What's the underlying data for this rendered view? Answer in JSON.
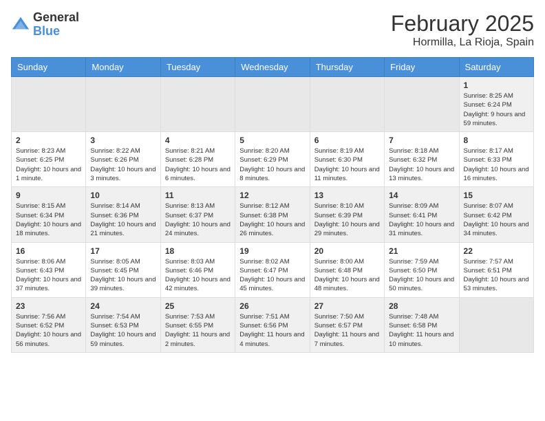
{
  "header": {
    "logo": {
      "general": "General",
      "blue": "Blue"
    },
    "title": "February 2025",
    "location": "Hormilla, La Rioja, Spain"
  },
  "calendar": {
    "days_of_week": [
      "Sunday",
      "Monday",
      "Tuesday",
      "Wednesday",
      "Thursday",
      "Friday",
      "Saturday"
    ],
    "weeks": [
      [
        {
          "day": "",
          "empty": true
        },
        {
          "day": "",
          "empty": true
        },
        {
          "day": "",
          "empty": true
        },
        {
          "day": "",
          "empty": true
        },
        {
          "day": "",
          "empty": true
        },
        {
          "day": "",
          "empty": true
        },
        {
          "day": "1",
          "sunrise": "Sunrise: 8:25 AM",
          "sunset": "Sunset: 6:24 PM",
          "daylight": "Daylight: 9 hours and 59 minutes."
        }
      ],
      [
        {
          "day": "2",
          "sunrise": "Sunrise: 8:23 AM",
          "sunset": "Sunset: 6:25 PM",
          "daylight": "Daylight: 10 hours and 1 minute."
        },
        {
          "day": "3",
          "sunrise": "Sunrise: 8:22 AM",
          "sunset": "Sunset: 6:26 PM",
          "daylight": "Daylight: 10 hours and 3 minutes."
        },
        {
          "day": "4",
          "sunrise": "Sunrise: 8:21 AM",
          "sunset": "Sunset: 6:28 PM",
          "daylight": "Daylight: 10 hours and 6 minutes."
        },
        {
          "day": "5",
          "sunrise": "Sunrise: 8:20 AM",
          "sunset": "Sunset: 6:29 PM",
          "daylight": "Daylight: 10 hours and 8 minutes."
        },
        {
          "day": "6",
          "sunrise": "Sunrise: 8:19 AM",
          "sunset": "Sunset: 6:30 PM",
          "daylight": "Daylight: 10 hours and 11 minutes."
        },
        {
          "day": "7",
          "sunrise": "Sunrise: 8:18 AM",
          "sunset": "Sunset: 6:32 PM",
          "daylight": "Daylight: 10 hours and 13 minutes."
        },
        {
          "day": "8",
          "sunrise": "Sunrise: 8:17 AM",
          "sunset": "Sunset: 6:33 PM",
          "daylight": "Daylight: 10 hours and 16 minutes."
        }
      ],
      [
        {
          "day": "9",
          "sunrise": "Sunrise: 8:15 AM",
          "sunset": "Sunset: 6:34 PM",
          "daylight": "Daylight: 10 hours and 18 minutes."
        },
        {
          "day": "10",
          "sunrise": "Sunrise: 8:14 AM",
          "sunset": "Sunset: 6:36 PM",
          "daylight": "Daylight: 10 hours and 21 minutes."
        },
        {
          "day": "11",
          "sunrise": "Sunrise: 8:13 AM",
          "sunset": "Sunset: 6:37 PM",
          "daylight": "Daylight: 10 hours and 24 minutes."
        },
        {
          "day": "12",
          "sunrise": "Sunrise: 8:12 AM",
          "sunset": "Sunset: 6:38 PM",
          "daylight": "Daylight: 10 hours and 26 minutes."
        },
        {
          "day": "13",
          "sunrise": "Sunrise: 8:10 AM",
          "sunset": "Sunset: 6:39 PM",
          "daylight": "Daylight: 10 hours and 29 minutes."
        },
        {
          "day": "14",
          "sunrise": "Sunrise: 8:09 AM",
          "sunset": "Sunset: 6:41 PM",
          "daylight": "Daylight: 10 hours and 31 minutes."
        },
        {
          "day": "15",
          "sunrise": "Sunrise: 8:07 AM",
          "sunset": "Sunset: 6:42 PM",
          "daylight": "Daylight: 10 hours and 34 minutes."
        }
      ],
      [
        {
          "day": "16",
          "sunrise": "Sunrise: 8:06 AM",
          "sunset": "Sunset: 6:43 PM",
          "daylight": "Daylight: 10 hours and 37 minutes."
        },
        {
          "day": "17",
          "sunrise": "Sunrise: 8:05 AM",
          "sunset": "Sunset: 6:45 PM",
          "daylight": "Daylight: 10 hours and 39 minutes."
        },
        {
          "day": "18",
          "sunrise": "Sunrise: 8:03 AM",
          "sunset": "Sunset: 6:46 PM",
          "daylight": "Daylight: 10 hours and 42 minutes."
        },
        {
          "day": "19",
          "sunrise": "Sunrise: 8:02 AM",
          "sunset": "Sunset: 6:47 PM",
          "daylight": "Daylight: 10 hours and 45 minutes."
        },
        {
          "day": "20",
          "sunrise": "Sunrise: 8:00 AM",
          "sunset": "Sunset: 6:48 PM",
          "daylight": "Daylight: 10 hours and 48 minutes."
        },
        {
          "day": "21",
          "sunrise": "Sunrise: 7:59 AM",
          "sunset": "Sunset: 6:50 PM",
          "daylight": "Daylight: 10 hours and 50 minutes."
        },
        {
          "day": "22",
          "sunrise": "Sunrise: 7:57 AM",
          "sunset": "Sunset: 6:51 PM",
          "daylight": "Daylight: 10 hours and 53 minutes."
        }
      ],
      [
        {
          "day": "23",
          "sunrise": "Sunrise: 7:56 AM",
          "sunset": "Sunset: 6:52 PM",
          "daylight": "Daylight: 10 hours and 56 minutes."
        },
        {
          "day": "24",
          "sunrise": "Sunrise: 7:54 AM",
          "sunset": "Sunset: 6:53 PM",
          "daylight": "Daylight: 10 hours and 59 minutes."
        },
        {
          "day": "25",
          "sunrise": "Sunrise: 7:53 AM",
          "sunset": "Sunset: 6:55 PM",
          "daylight": "Daylight: 11 hours and 2 minutes."
        },
        {
          "day": "26",
          "sunrise": "Sunrise: 7:51 AM",
          "sunset": "Sunset: 6:56 PM",
          "daylight": "Daylight: 11 hours and 4 minutes."
        },
        {
          "day": "27",
          "sunrise": "Sunrise: 7:50 AM",
          "sunset": "Sunset: 6:57 PM",
          "daylight": "Daylight: 11 hours and 7 minutes."
        },
        {
          "day": "28",
          "sunrise": "Sunrise: 7:48 AM",
          "sunset": "Sunset: 6:58 PM",
          "daylight": "Daylight: 11 hours and 10 minutes."
        },
        {
          "day": "",
          "empty": true
        }
      ]
    ]
  }
}
